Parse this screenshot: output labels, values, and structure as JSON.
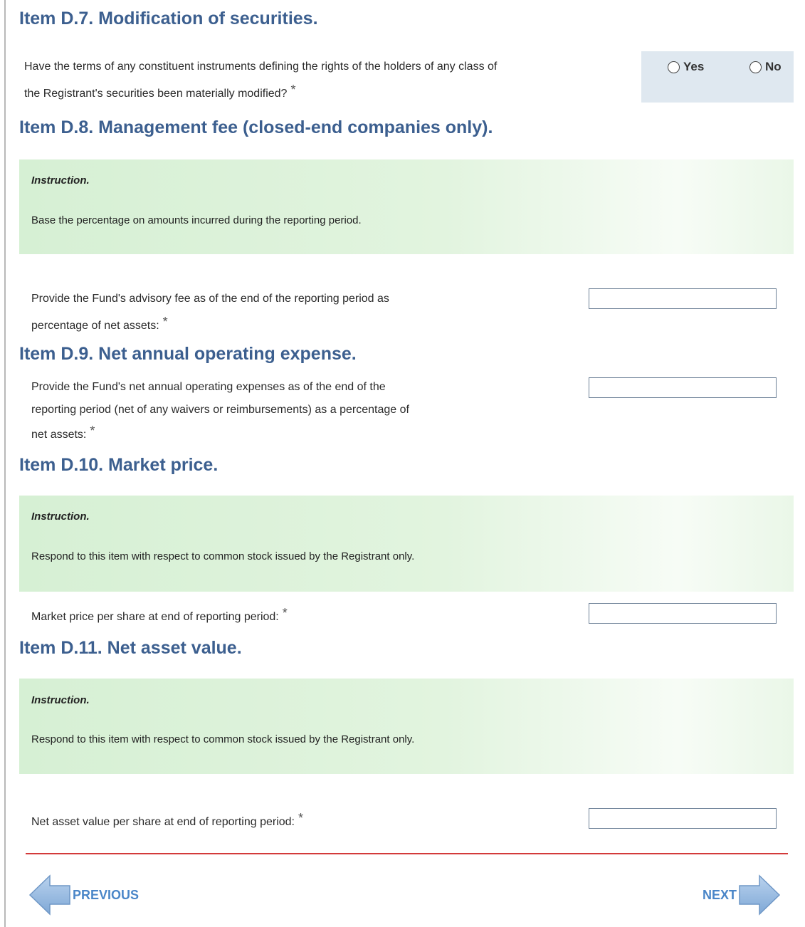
{
  "d7": {
    "heading": "Item D.7. Modification of securities.",
    "question_line1": "Have the terms of any constituent instruments defining the rights of the holders of any class of",
    "question_line2": "the Registrant's securities been materially modified?",
    "required_mark": "*",
    "options": [
      "Yes",
      "No"
    ]
  },
  "d8": {
    "heading": "Item D.8. Management fee (closed-end companies only).",
    "instruction_title": "Instruction.",
    "instruction_text": "Base the percentage on amounts incurred during the reporting period.",
    "question_line1": "Provide the Fund's advisory fee as of the end of the reporting period as",
    "question_line2": "percentage of net assets:",
    "required_mark": "*",
    "value": ""
  },
  "d9": {
    "heading": "Item D.9. Net annual operating expense.",
    "question_line1": "Provide the Fund's net annual operating expenses as of the end of the",
    "question_line2": "reporting period (net of any waivers or reimbursements) as a percentage of",
    "question_line3": "net assets:",
    "required_mark": "*",
    "value": ""
  },
  "d10": {
    "heading": "Item D.10. Market price.",
    "instruction_title": "Instruction.",
    "instruction_text": "Respond to this item with respect to common stock issued by the Registrant only.",
    "question": "Market price per share at end of reporting period:",
    "required_mark": "*",
    "value": ""
  },
  "d11": {
    "heading": "Item D.11. Net asset value.",
    "instruction_title": "Instruction.",
    "instruction_text": "Respond to this item with respect to common stock issued by the Registrant only.",
    "question": "Net asset value per share at end of reporting period:",
    "required_mark": "*",
    "value": ""
  },
  "nav": {
    "previous_label": "PREVIOUS",
    "next_label": "NEXT"
  },
  "colors": {
    "heading": "#3c5f8f",
    "instruction_bg": "#d6f0d4",
    "radio_bg": "#dfe8f0",
    "divider": "#d33a3a",
    "nav_arrow": "#8fb4dc",
    "nav_text": "#4a86c8"
  },
  "icons": {
    "previous": "left-arrow-icon",
    "next": "right-arrow-icon"
  }
}
